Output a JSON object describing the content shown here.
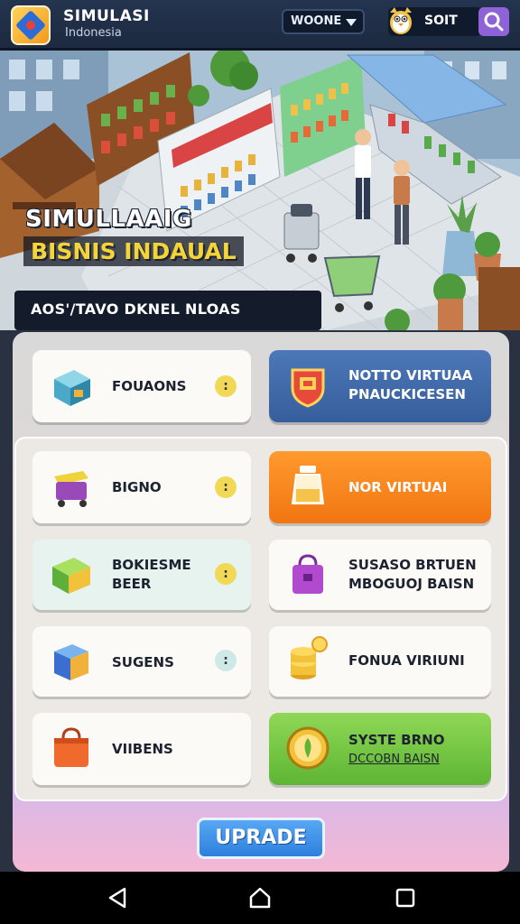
{
  "header": {
    "title": "SIMULASI",
    "subtitle": "Indonesia",
    "region_label": "WOONE",
    "coin_label": "SOIT",
    "logo_icon": "isometric-cube-logo",
    "mascot_icon": "penguin-mascot-icon",
    "search_icon": "search-icon"
  },
  "hero": {
    "title_line1": "SIMULLAAIG",
    "title_line2": "BISNIS INDAUAL",
    "ribbon_text": "AOS'/TAVO DKNEL NLOAS"
  },
  "cards": [
    {
      "label_lines": [
        "FOUAONS"
      ],
      "style": "white",
      "icon": "cash-register-icon",
      "has_info": true
    },
    {
      "label_lines": [
        "NOTTO VIRTUAA",
        "PNAUCKICESEN"
      ],
      "style": "blue",
      "icon": "shop-shield-icon",
      "has_info": false
    },
    {
      "label_lines": [
        "BIGNO"
      ],
      "style": "white",
      "icon": "cart-icon",
      "has_info": true
    },
    {
      "label_lines": [
        "NOR VIRTUAI"
      ],
      "style": "orange",
      "icon": "jar-icon",
      "has_info": false
    },
    {
      "label_lines": [
        "BOKIESME",
        "BEER"
      ],
      "style": "mint",
      "icon": "green-box-icon",
      "has_info": true
    },
    {
      "label_lines": [
        "SUSASO BRTUEN",
        "MBOGUOJ BAISN"
      ],
      "style": "white",
      "icon": "purple-bag-icon",
      "has_info": false
    },
    {
      "label_lines": [
        "SUGENS"
      ],
      "style": "white",
      "icon": "blue-cube-icon",
      "has_info": true
    },
    {
      "label_lines": [
        "FONUA VIRIUNI"
      ],
      "style": "white",
      "icon": "coin-stack-icon",
      "has_info": false
    },
    {
      "label_lines": [
        "VIIBENS"
      ],
      "style": "white",
      "icon": "shopping-bag-icon",
      "has_info": false
    },
    {
      "label_lines": [
        "SYSTE BRNO",
        "DCCOBN BAISN"
      ],
      "style": "green",
      "icon": "gold-seal-icon",
      "has_info": false
    }
  ],
  "info_symbol": ":",
  "upgrade_label": "UPRADE",
  "colors": {
    "accent_blue": "#375e9c",
    "accent_orange": "#f27512",
    "accent_green": "#5eb534",
    "title_yellow": "#f5d437"
  },
  "navbar": {
    "icons": [
      "back-icon",
      "home-icon",
      "recents-icon"
    ]
  }
}
